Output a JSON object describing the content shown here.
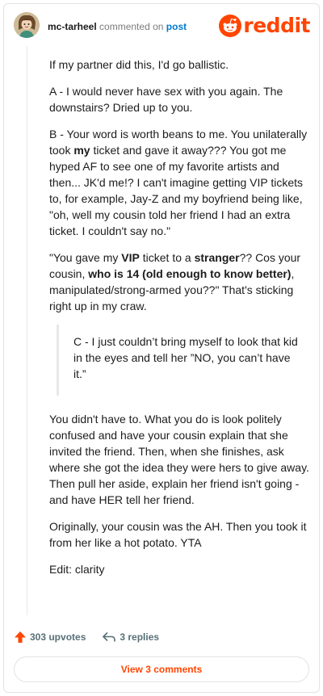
{
  "header": {
    "username": "mc-tarheel",
    "action_text": "commented on",
    "post_link": "post",
    "brand": "reddit"
  },
  "comment": {
    "p1": "If my partner did this, I'd go ballistic.",
    "p2": "A - I would never have sex with you again. The downstairs? Dried up to you.",
    "p3": {
      "a": "B - Your word is worth beans to me. You unilaterally took ",
      "b": "my",
      "c": " ticket and gave it away??? You got me hyped AF to see one of my favorite artists and then... JK'd me!? I can't imagine getting VIP tickets to, for example, Jay-Z and my boyfriend being like, \"oh, well my cousin told her friend I had an extra ticket. I couldn't say no.\""
    },
    "p4": {
      "a": "\"You gave my ",
      "b": "VIP",
      "c": " ticket to a ",
      "d": "stranger",
      "e": "?? Cos your cousin, ",
      "f": "who is 14 (old enough to know better)",
      "g": ", manipulated/strong-armed you??\" That's sticking right up in my craw."
    },
    "quote": "C - I just couldn’t bring myself to look that kid in the eyes and tell her ”NO, you can’t have it.”",
    "p5": "You didn't have to. What you do is look politely confused and have your cousin explain that she invited the friend. Then, when she finishes, ask where she got the idea they were hers to give away. Then pull her aside, explain her friend isn't going - and have HER tell her friend.",
    "p6": "Originally, your cousin was the AH. Then you took it from her like a hot potato. YTA",
    "p7": "Edit: clarity"
  },
  "actions": {
    "upvotes": "303 upvotes",
    "replies": "3 replies"
  },
  "footer": {
    "view_comments": "View 3 comments"
  },
  "colors": {
    "brand": "#ff4500",
    "link": "#0079d3",
    "muted": "#576f76"
  }
}
